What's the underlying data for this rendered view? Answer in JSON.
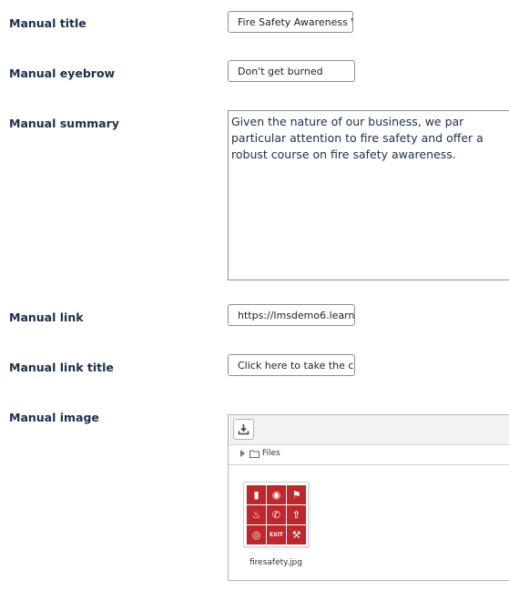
{
  "form": {
    "title_label": "Manual title",
    "title_value": "Fire Safety Awareness V",
    "eyebrow_label": "Manual eyebrow",
    "eyebrow_value": "Don't get burned",
    "summary_label": "Manual summary",
    "summary_value": "Given the nature of our business, we par particular attention to fire safety and offer a robust course on fire safety awareness.",
    "link_label": "Manual link",
    "link_value": "https://lmsdemo6.learn",
    "link_title_label": "Manual link title",
    "link_title_value": "Click here to take the c",
    "image_label": "Manual image"
  },
  "file_manager": {
    "toolbar_icon": "download-icon",
    "breadcrumb": "Files",
    "file_name": "firesafety.jpg",
    "thumb_color": "#c0272d"
  }
}
